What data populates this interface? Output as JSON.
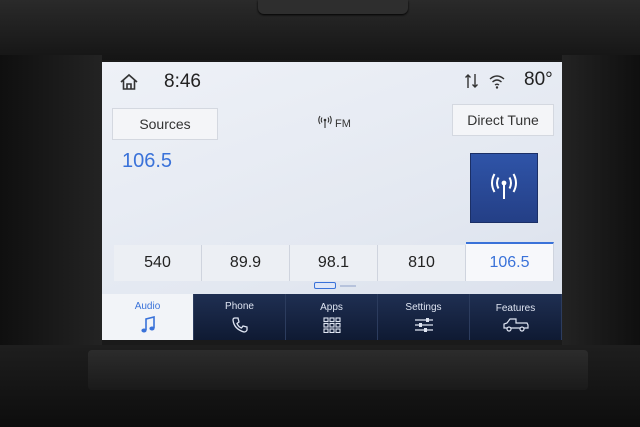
{
  "status": {
    "time": "8:46",
    "temperature": "80°"
  },
  "source": {
    "sources_label": "Sources",
    "band": "FM",
    "direct_tune_label": "Direct Tune",
    "frequency": "106.5"
  },
  "presets": [
    "540",
    "89.9",
    "98.1",
    "810",
    "106.5"
  ],
  "active_preset_index": 4,
  "nav": {
    "audio": "Audio",
    "phone": "Phone",
    "apps": "Apps",
    "settings": "Settings",
    "features": "Features"
  },
  "colors": {
    "accent": "#3a72d9",
    "nav_background": "#1f2f52",
    "tile": "#2f54a8"
  },
  "icons": [
    "home-icon",
    "signal-icon",
    "wifi-icon",
    "antenna-icon",
    "radio-tower-icon",
    "music-note-icon",
    "phone-icon",
    "apps-grid-icon",
    "sliders-icon",
    "truck-icon"
  ]
}
